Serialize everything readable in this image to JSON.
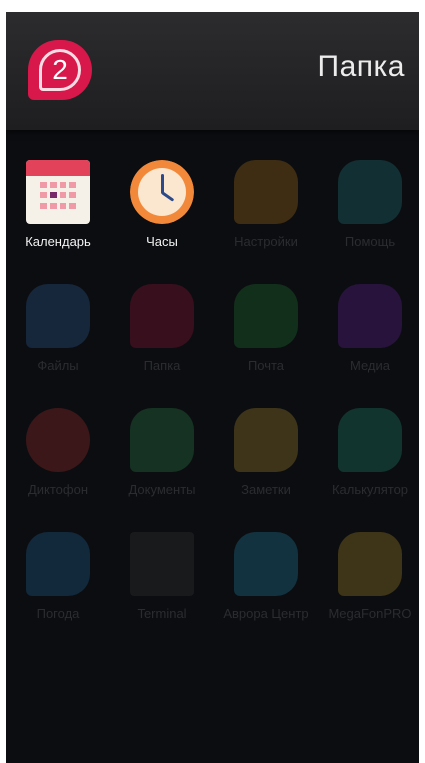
{
  "folder": {
    "badge_number": "2",
    "title": "Папка"
  },
  "apps": [
    {
      "label": "Календарь",
      "icon": "calendar-icon",
      "color": "#e2425a"
    },
    {
      "label": "Часы",
      "icon": "clock-icon",
      "color": "#f2893a"
    },
    {
      "label": "Настройки",
      "icon": "settings-icon",
      "color": "#f0a020"
    },
    {
      "label": "Помощь",
      "icon": "help-icon",
      "color": "#2aa8b8"
    },
    {
      "label": "Файлы",
      "icon": "files-icon",
      "color": "#3a7fd8"
    },
    {
      "label": "Папка",
      "icon": "folder-icon",
      "color": "#d8174a"
    },
    {
      "label": "Почта",
      "icon": "mail-icon",
      "color": "#2aa84a"
    },
    {
      "label": "Медиа",
      "icon": "media-icon",
      "color": "#8a2ad8"
    },
    {
      "label": "Диктофон",
      "icon": "recorder-icon",
      "color": "#e23a3a"
    },
    {
      "label": "Документы",
      "icon": "documents-icon",
      "color": "#3ab86a"
    },
    {
      "label": "Заметки",
      "icon": "notes-icon",
      "color": "#f0c040"
    },
    {
      "label": "Калькулятор",
      "icon": "calculator-icon",
      "color": "#2ac0a0"
    },
    {
      "label": "Погода",
      "icon": "weather-icon",
      "color": "#2a8ad8"
    },
    {
      "label": "Terminal",
      "icon": "terminal-icon",
      "color": "#3ad870"
    },
    {
      "label": "Аврора Центр",
      "icon": "store-icon",
      "color": "#2ab8e8"
    },
    {
      "label": "MegaFonPRO",
      "icon": "megafon-icon",
      "color": "#f0c030"
    }
  ]
}
